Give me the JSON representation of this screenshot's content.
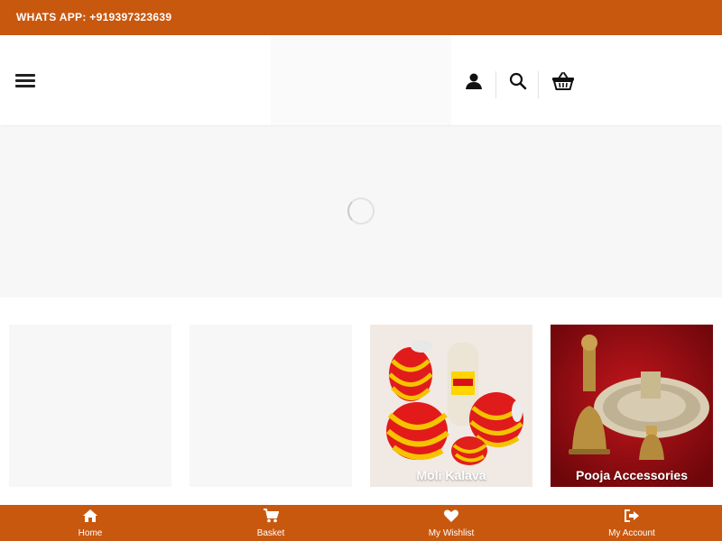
{
  "topbar": {
    "contact_text": "WHATS APP: +919397323639"
  },
  "header": {
    "menu_icon": "hamburger-menu-icon",
    "actions": [
      {
        "name": "account",
        "icon": "user-icon"
      },
      {
        "name": "search",
        "icon": "search-icon"
      },
      {
        "name": "basket",
        "icon": "basket-icon"
      }
    ]
  },
  "hero": {
    "state": "loading",
    "icon": "spinner-icon"
  },
  "categories": [
    {
      "caption": "",
      "image": "placeholder"
    },
    {
      "caption": "",
      "image": "placeholder"
    },
    {
      "caption": "Moli Kalava",
      "image": "thread-spools"
    },
    {
      "caption": "Pooja Accessories",
      "image": "brass-pooja-items"
    }
  ],
  "bottom_nav": [
    {
      "label": "Home",
      "icon": "home-icon"
    },
    {
      "label": "Basket",
      "icon": "cart-icon"
    },
    {
      "label": "My Wishlist",
      "icon": "heart-icon"
    },
    {
      "label": "My Account",
      "icon": "sign-out-icon"
    }
  ],
  "colors": {
    "brand": "#c9580f",
    "accent_red": "#a01016",
    "text_dark": "#222222"
  }
}
